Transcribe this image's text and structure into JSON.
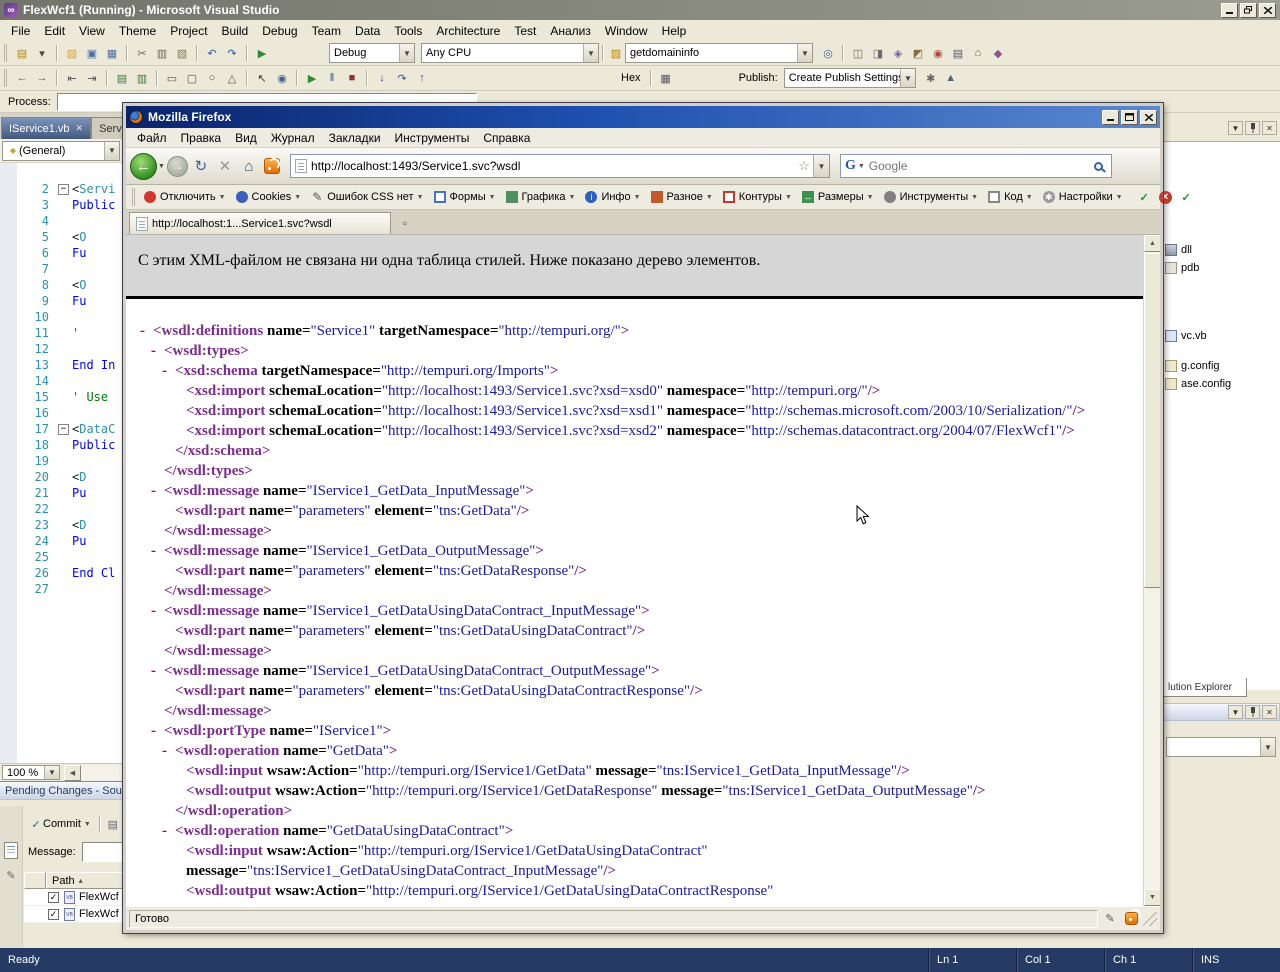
{
  "colors": {
    "xml-tag": "#7b2d90",
    "xml-attr": "#000000",
    "xml-val": "#1a1aa6",
    "xml-marker": "#c40000",
    "vs-status-bg": "#253a64",
    "ff-title-1": "#0a246a",
    "ff-title-2": "#5a88cf"
  },
  "vs": {
    "title": "FlexWcf1 (Running) - Microsoft Visual Studio",
    "menu": [
      "File",
      "Edit",
      "View",
      "Theme",
      "Project",
      "Build",
      "Debug",
      "Team",
      "Data",
      "Tools",
      "Architecture",
      "Test",
      "Анализ",
      "Window",
      "Help"
    ],
    "toolbar1": {
      "icons_a": [
        {
          "n": "new-item-icon",
          "g": "▤",
          "c": "#b8860b"
        },
        {
          "n": "new-item-dropdown-icon",
          "g": "▾",
          "c": "#444"
        },
        {
          "sep": 1
        },
        {
          "n": "open-file-icon",
          "g": "▨",
          "c": "#caa54a"
        },
        {
          "n": "save-icon",
          "g": "▣",
          "c": "#4a6fa5"
        },
        {
          "n": "save-all-icon",
          "g": "▦",
          "c": "#4a6fa5"
        },
        {
          "sep": 1
        },
        {
          "n": "cut-icon",
          "g": "✂",
          "c": "#666666"
        },
        {
          "n": "copy-icon",
          "g": "▥",
          "c": "#666666"
        },
        {
          "n": "paste-icon",
          "g": "▧",
          "c": "#8a7a4a"
        },
        {
          "sep": 1
        },
        {
          "n": "undo-icon",
          "g": "↶",
          "c": "#2a5caa"
        },
        {
          "n": "redo-icon",
          "g": "↷",
          "c": "#2a5caa"
        },
        {
          "sep": 1
        },
        {
          "n": "start-debug-icon",
          "g": "▶",
          "c": "#2e8b2e"
        }
      ],
      "debug_combo": "Debug",
      "cpu_combo": "Any CPU",
      "search_combo": "getdomaininfo",
      "icons_b": [
        {
          "n": "find-icon",
          "g": "◎",
          "c": "#44628e"
        },
        {
          "sep": 1
        },
        {
          "n": "solution-explorer-icon",
          "g": "◫",
          "c": "#6b6b6b"
        },
        {
          "n": "properties-window-icon",
          "g": "◨",
          "c": "#6b6b6b"
        },
        {
          "n": "object-browser-icon",
          "g": "◈",
          "c": "#7a5aa0"
        },
        {
          "n": "toolbox-icon",
          "g": "◩",
          "c": "#8a6a3a"
        },
        {
          "n": "error-list-icon",
          "g": "◉",
          "c": "#b04a3a"
        },
        {
          "n": "output-window-icon",
          "g": "▤",
          "c": "#555566"
        },
        {
          "n": "start-page-icon",
          "g": "⌂",
          "c": "#447744"
        },
        {
          "n": "extension-manager-icon",
          "g": "◆",
          "c": "#885599"
        }
      ]
    },
    "toolbar2": {
      "icons_a": [
        {
          "n": "navigate-backward-icon",
          "g": "←",
          "c": "#3a62a8"
        },
        {
          "n": "navigate-forward-icon",
          "g": "→",
          "c": "#3a62a8"
        },
        {
          "sep": 1
        },
        {
          "n": "decrease-indent-icon",
          "g": "⇤",
          "c": "#555555"
        },
        {
          "n": "increase-indent-icon",
          "g": "⇥",
          "c": "#555555"
        },
        {
          "sep": 1
        },
        {
          "n": "comment-icon",
          "g": "▤",
          "c": "#3a7a3a"
        },
        {
          "n": "uncomment-icon",
          "g": "▥",
          "c": "#3a7a3a"
        },
        {
          "sep": 1
        },
        {
          "n": "rectangle-tool-icon",
          "g": "▭",
          "c": "#555555"
        },
        {
          "n": "rounded-rectangle-tool-icon",
          "g": "▢",
          "c": "#555555"
        },
        {
          "n": "ellipse-tool-icon",
          "g": "○",
          "c": "#555555"
        },
        {
          "n": "polygon-tool-icon",
          "g": "△",
          "c": "#555555"
        },
        {
          "sep": 1
        },
        {
          "n": "pointer-icon",
          "g": "↖",
          "c": "#333333"
        },
        {
          "n": "zoom-tool-icon",
          "g": "◉",
          "c": "#44628e"
        },
        {
          "sep": 1
        },
        {
          "n": "run-icon",
          "g": "▶",
          "c": "#2e8b2e"
        },
        {
          "n": "pause-icon",
          "g": "‖",
          "c": "#33528e"
        },
        {
          "n": "stop-icon",
          "g": "■",
          "c": "#8e3333"
        },
        {
          "sep": 1
        },
        {
          "n": "step-into-icon",
          "g": "↓",
          "c": "#33528e"
        },
        {
          "n": "step-over-icon",
          "g": "↷",
          "c": "#33528e"
        },
        {
          "n": "step-out-icon",
          "g": "↑",
          "c": "#33528e"
        }
      ],
      "hex_label": "Hex",
      "icons_b": [
        {
          "sep": 1
        },
        {
          "n": "memory-window-icon",
          "g": "▦",
          "c": "#555566"
        }
      ],
      "publish_label": "Publish:",
      "publish_combo": "Create Publish Settings",
      "icons_c": [
        {
          "n": "publish-settings-icon",
          "g": "✱",
          "c": "#666666"
        },
        {
          "n": "web-one-click-icon",
          "g": "▲",
          "c": "#556677"
        }
      ]
    },
    "process_label": "Process:",
    "tabs": [
      {
        "label": "IService1.vb"
      },
      {
        "label": "Serv"
      }
    ],
    "nav_combo": "(General)",
    "editor": {
      "lines": [
        {
          "n": 2,
          "fold": true,
          "text": "<Servi",
          "cls": "attr"
        },
        {
          "n": 3,
          "text": "Public",
          "cls": "kw"
        },
        {
          "n": 4,
          "text": "",
          "cls": ""
        },
        {
          "n": 5,
          "text": "<O",
          "cls": "attr"
        },
        {
          "n": 6,
          "text": "Fu",
          "cls": "kw"
        },
        {
          "n": 7,
          "text": "",
          "cls": ""
        },
        {
          "n": 8,
          "text": "<O",
          "cls": "attr"
        },
        {
          "n": 9,
          "text": "Fu",
          "cls": "kw"
        },
        {
          "n": 10,
          "text": "",
          "cls": ""
        },
        {
          "n": 11,
          "text": "'",
          "cls": "com"
        },
        {
          "n": 12,
          "text": "",
          "cls": ""
        },
        {
          "n": 13,
          "text": "End In",
          "cls": "kw"
        },
        {
          "n": 14,
          "text": "",
          "cls": ""
        },
        {
          "n": 15,
          "text": "' Use",
          "cls": "com"
        },
        {
          "n": 16,
          "text": "",
          "cls": ""
        },
        {
          "n": 17,
          "fold": true,
          "text": "<DataC",
          "cls": "attr"
        },
        {
          "n": 18,
          "text": "Public",
          "cls": "kw"
        },
        {
          "n": 19,
          "text": "",
          "cls": ""
        },
        {
          "n": 20,
          "text": "<D",
          "cls": "attr"
        },
        {
          "n": 21,
          "text": "Pu",
          "cls": "kw"
        },
        {
          "n": 22,
          "text": "",
          "cls": ""
        },
        {
          "n": 23,
          "text": "<D",
          "cls": "attr"
        },
        {
          "n": 24,
          "text": "Pu",
          "cls": "kw"
        },
        {
          "n": 25,
          "text": "",
          "cls": ""
        },
        {
          "n": 26,
          "text": "End Cl",
          "cls": "kw"
        },
        {
          "n": 27,
          "text": "",
          "cls": ""
        }
      ]
    },
    "zoom_combo": "100 %",
    "pending": {
      "title": "Pending Changes - Sour",
      "commit_label": "Commit",
      "message_label": "Message:",
      "path_header": "Path",
      "files": [
        {
          "name": "FlexWcf",
          "checked": true
        },
        {
          "name": "FlexWcf",
          "checked": true
        }
      ]
    },
    "solution": {
      "files": [
        {
          "label": "dll",
          "icon": "ic-assembly",
          "name": "assembly-file-icon"
        },
        {
          "label": "pdb",
          "icon": "ic-pdb",
          "name": "pdb-file-icon"
        },
        {
          "label": "vc.vb",
          "icon": "ic-vb",
          "name": "vb-file-icon"
        },
        {
          "label": "g.config",
          "icon": "ic-config",
          "name": "config-file-icon"
        },
        {
          "label": "ase.config",
          "icon": "ic-config",
          "name": "config-file-icon"
        }
      ],
      "tab_label": "lution Explorer"
    },
    "statusbar": {
      "ready": "Ready",
      "ln": "Ln 1",
      "col": "Col 1",
      "ch": "Ch 1",
      "mode": "INS"
    }
  },
  "firefox": {
    "title": "Mozilla Firefox",
    "menu": [
      "Файл",
      "Правка",
      "Вид",
      "Журнал",
      "Закладки",
      "Инструменты",
      "Справка"
    ],
    "url": "http://localhost:1493/Service1.svc?wsdl",
    "search_placeholder": "Google",
    "devbar": [
      {
        "name": "disable",
        "label": "Отключить",
        "shape": "circle",
        "color": "#cf3a2c"
      },
      {
        "name": "cookies",
        "label": "Cookies",
        "shape": "circle",
        "color": "#3a5fbf"
      },
      {
        "name": "css",
        "label": "Ошибок CSS нет",
        "shape": "glyph",
        "glyph": "✎",
        "color": "#555555"
      },
      {
        "name": "forms",
        "label": "Формы",
        "shape": "outline",
        "color": "#4a72c4"
      },
      {
        "name": "images",
        "label": "Графика",
        "shape": "square",
        "color": "#4f8f5f"
      },
      {
        "name": "info",
        "label": "Инфо",
        "shape": "circle",
        "glyph": "i",
        "color": "#2b5fc0"
      },
      {
        "name": "misc",
        "label": "Разное",
        "shape": "square",
        "color": "#c05a2a"
      },
      {
        "name": "outline",
        "label": "Контуры",
        "shape": "outline",
        "color": "#c0392b"
      },
      {
        "name": "resize",
        "label": "Размеры",
        "shape": "square",
        "glyph": "↔",
        "color": "#3f8f4f"
      },
      {
        "name": "tools",
        "label": "Инструменты",
        "shape": "circle",
        "color": "#808080"
      },
      {
        "name": "source",
        "label": "Код",
        "shape": "outline",
        "color": "#888888"
      },
      {
        "name": "options",
        "label": "Настройки",
        "shape": "circle",
        "glyph": "✱",
        "color": "#9a9a9a"
      }
    ],
    "devbar_status": [
      {
        "name": "html-valid-check-icon",
        "glyph": "✓",
        "color": "#2a8f2a",
        "bg": "transparent"
      },
      {
        "name": "errors-indicator-icon",
        "glyph": "×",
        "color": "#ffffff",
        "bg": "#c0392b",
        "circle": true
      },
      {
        "name": "css-valid-check-icon",
        "glyph": "✓",
        "color": "#2a8f2a",
        "bg": "transparent"
      }
    ],
    "tab_title": "http://localhost:1...Service1.svc?wsdl",
    "notice": "С этим XML-файлом не связана ни одна таблица стилей. Ниже показано дерево элементов.",
    "status": "Готово",
    "xml_rows": [
      {
        "l": 0,
        "m": 1,
        "x": "<wsdl:definitions name=\"Service1\" targetNamespace=\"http://tempuri.org/\">"
      },
      {
        "l": 1,
        "m": 1,
        "x": "<wsdl:types>"
      },
      {
        "l": 2,
        "m": 1,
        "x": "<xsd:schema targetNamespace=\"http://tempuri.org/Imports\">"
      },
      {
        "l": 3,
        "m": 0,
        "x": "<xsd:import schemaLocation=\"http://localhost:1493/Service1.svc?xsd=xsd0\" namespace=\"http://tempuri.org/\"/>"
      },
      {
        "l": 3,
        "m": 0,
        "x": "<xsd:import schemaLocation=\"http://localhost:1493/Service1.svc?xsd=xsd1\" namespace=\"http://schemas.microsoft.com/2003/10/Serialization/\"/>"
      },
      {
        "l": 3,
        "m": 0,
        "x": "<xsd:import schemaLocation=\"http://localhost:1493/Service1.svc?xsd=xsd2\" namespace=\"http://schemas.datacontract.org/2004/07/FlexWcf1\"/>"
      },
      {
        "l": 2,
        "m": 0,
        "x": "</xsd:schema>"
      },
      {
        "l": 1,
        "m": 0,
        "x": "</wsdl:types>"
      },
      {
        "l": 1,
        "m": 1,
        "x": "<wsdl:message name=\"IService1_GetData_InputMessage\">"
      },
      {
        "l": 2,
        "m": 0,
        "x": "<wsdl:part name=\"parameters\" element=\"tns:GetData\"/>"
      },
      {
        "l": 1,
        "m": 0,
        "x": "</wsdl:message>"
      },
      {
        "l": 1,
        "m": 1,
        "x": "<wsdl:message name=\"IService1_GetData_OutputMessage\">"
      },
      {
        "l": 2,
        "m": 0,
        "x": "<wsdl:part name=\"parameters\" element=\"tns:GetDataResponse\"/>"
      },
      {
        "l": 1,
        "m": 0,
        "x": "</wsdl:message>"
      },
      {
        "l": 1,
        "m": 1,
        "x": "<wsdl:message name=\"IService1_GetDataUsingDataContract_InputMessage\">"
      },
      {
        "l": 2,
        "m": 0,
        "x": "<wsdl:part name=\"parameters\" element=\"tns:GetDataUsingDataContract\"/>"
      },
      {
        "l": 1,
        "m": 0,
        "x": "</wsdl:message>"
      },
      {
        "l": 1,
        "m": 1,
        "x": "<wsdl:message name=\"IService1_GetDataUsingDataContract_OutputMessage\">"
      },
      {
        "l": 2,
        "m": 0,
        "x": "<wsdl:part name=\"parameters\" element=\"tns:GetDataUsingDataContractResponse\"/>"
      },
      {
        "l": 1,
        "m": 0,
        "x": "</wsdl:message>"
      },
      {
        "l": 1,
        "m": 1,
        "x": "<wsdl:portType name=\"IService1\">"
      },
      {
        "l": 2,
        "m": 1,
        "x": "<wsdl:operation name=\"GetData\">"
      },
      {
        "l": 3,
        "m": 0,
        "x": "<wsdl:input wsaw:Action=\"http://tempuri.org/IService1/GetData\" message=\"tns:IService1_GetData_InputMessage\"/>"
      },
      {
        "l": 3,
        "m": 0,
        "x": "<wsdl:output wsaw:Action=\"http://tempuri.org/IService1/GetDataResponse\" message=\"tns:IService1_GetData_OutputMessage\"/>"
      },
      {
        "l": 2,
        "m": 0,
        "x": "</wsdl:operation>"
      },
      {
        "l": 2,
        "m": 1,
        "x": "<wsdl:operation name=\"GetDataUsingDataContract\">"
      },
      {
        "l": 3,
        "m": 0,
        "x": "<wsdl:input wsaw:Action=\"http://tempuri.org/IService1/GetDataUsingDataContract\""
      },
      {
        "l": 3,
        "m": 0,
        "x": "message=\"tns:IService1_GetDataUsingDataContract_InputMessage\"/>"
      },
      {
        "l": 3,
        "m": 0,
        "x": "<wsdl:output wsaw:Action=\"http://tempuri.org/IService1/GetDataUsingDataContractResponse\""
      }
    ]
  }
}
